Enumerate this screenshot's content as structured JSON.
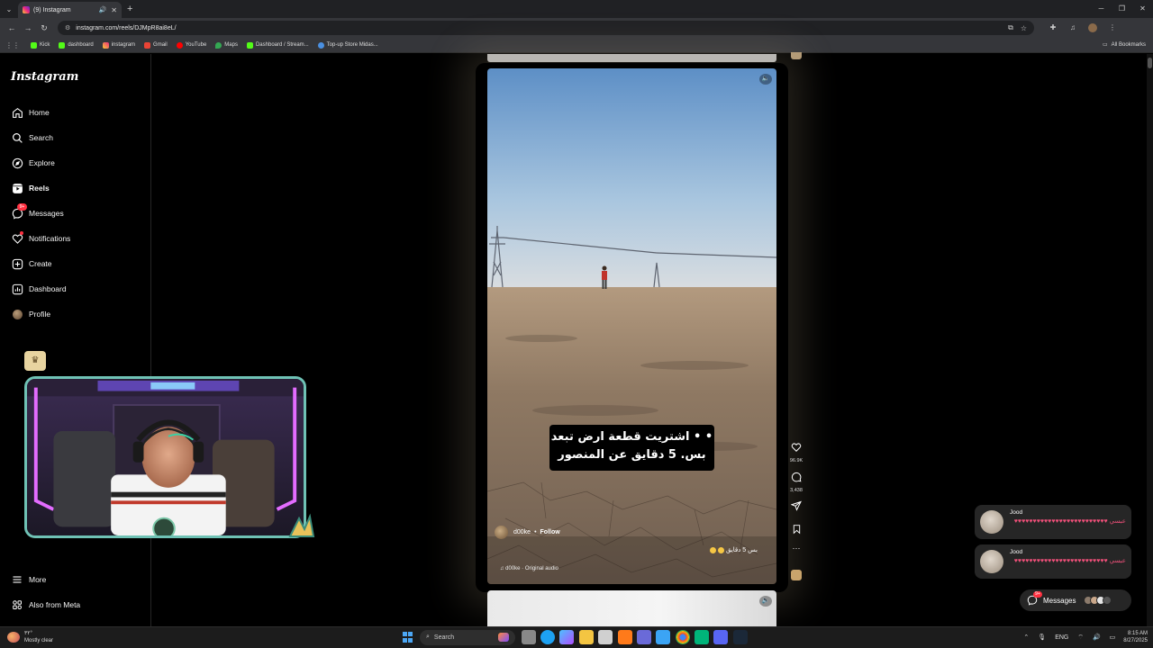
{
  "browser": {
    "tab_title": "(9) Instagram",
    "url": "instagram.com/reels/DJMpR8ai8eL/",
    "bookmarks": [
      "Kick",
      "dashboard",
      "instagram",
      "Gmail",
      "YouTube",
      "Maps",
      "Dashboard / Stream...",
      "Top-up Store Midas..."
    ],
    "all_bookmarks": "All Bookmarks"
  },
  "sidebar": {
    "logo": "Instagram",
    "items": [
      {
        "label": "Home",
        "icon": "home-icon"
      },
      {
        "label": "Search",
        "icon": "search-icon"
      },
      {
        "label": "Explore",
        "icon": "compass-icon"
      },
      {
        "label": "Reels",
        "icon": "reels-icon"
      },
      {
        "label": "Messages",
        "icon": "messenger-icon",
        "badge": "9+"
      },
      {
        "label": "Notifications",
        "icon": "heart-icon"
      },
      {
        "label": "Create",
        "icon": "plus-square-icon"
      },
      {
        "label": "Dashboard",
        "icon": "chart-icon"
      },
      {
        "label": "Profile",
        "icon": "avatar"
      }
    ],
    "more": "More",
    "also_from_meta": "Also from Meta"
  },
  "reel": {
    "caption_line1": "• • اشتريت قطعة ارض تبعد",
    "caption_line2": "بس. 5 دقايق عن المنصور",
    "username": "d00ke",
    "follow": "Follow",
    "description": "بس 5 دقايق",
    "audio": "d00ke · Original audio",
    "likes": "96.9K",
    "comments": "3,438"
  },
  "notifications": [
    {
      "name": "Jood",
      "message": "عبسي ♥♥♥♥♥♥♥♥♥♥♥♥♥♥♥♥♥♥♥♥♥♥♥♥♥"
    },
    {
      "name": "Jood",
      "message": "عبسي ♥♥♥♥♥♥♥♥♥♥♥♥♥♥♥♥♥♥♥♥♥♥♥♥♥"
    }
  ],
  "messages_pill": {
    "label": "Messages",
    "badge": "9+"
  },
  "taskbar": {
    "temp": "٣٢°",
    "weather": "Mostly clear",
    "search": "Search",
    "lang": "ENG",
    "time": "8:15 AM",
    "date": "8/27/2025"
  }
}
